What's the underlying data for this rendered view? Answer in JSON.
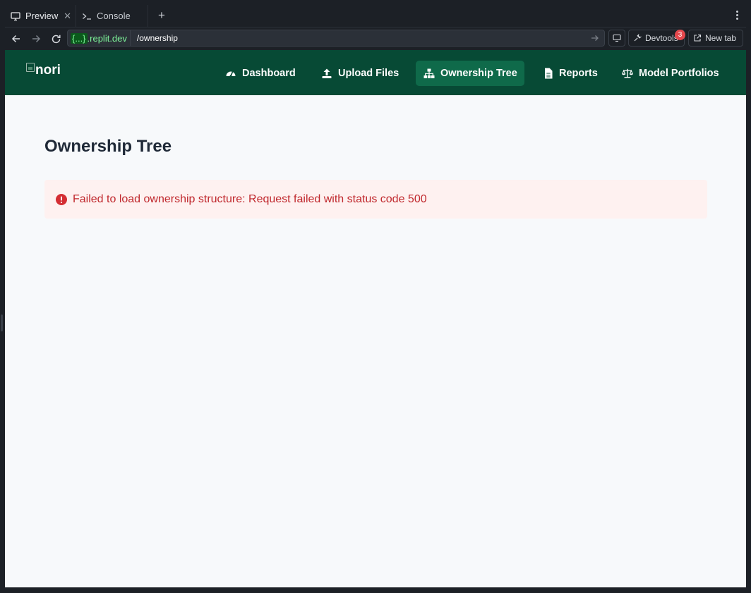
{
  "browser": {
    "tabs": [
      {
        "label": "Preview",
        "icon": "monitor-icon",
        "active": true
      },
      {
        "label": "Console",
        "icon": "terminal-icon",
        "active": false
      }
    ],
    "new_tab_symbol": "+",
    "address": {
      "domain_prefix": "{...}",
      "domain_suffix": ".replit.dev",
      "path": "/ownership"
    },
    "actions": {
      "devtools_label": "Devtools",
      "devtools_badge": "3",
      "new_tab_label": "New tab"
    }
  },
  "app": {
    "logo_alt": "nori",
    "nav": [
      {
        "label": "Dashboard",
        "icon": "gauge-icon"
      },
      {
        "label": "Upload Files",
        "icon": "upload-icon"
      },
      {
        "label": "Ownership Tree",
        "icon": "sitemap-icon",
        "active": true
      },
      {
        "label": "Reports",
        "icon": "document-icon"
      },
      {
        "label": "Model Portfolios",
        "icon": "scale-icon"
      }
    ],
    "page_title": "Ownership Tree",
    "error_message": "Failed to load ownership structure: Request failed with status code 500"
  },
  "colors": {
    "nav_background": "#074a35",
    "nav_active": "#0f6a4a",
    "error_text": "#c0282d",
    "error_background": "#fef1f0"
  }
}
